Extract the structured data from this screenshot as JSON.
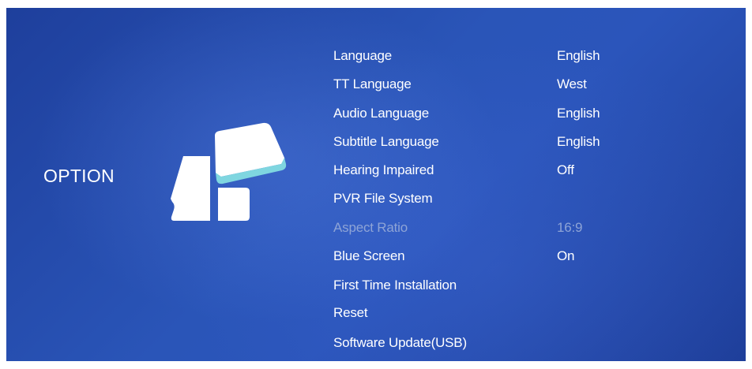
{
  "section": {
    "title": "OPTION"
  },
  "logo": {
    "icon": "option-settings-icon"
  },
  "colors": {
    "background": "#2a55b8",
    "text": "#ffffff",
    "disabled_text": "#8ea4d6",
    "logo_accent": "#7fd6e0"
  },
  "menu": {
    "items": [
      {
        "label": "Language",
        "value": "English",
        "enabled": true
      },
      {
        "label": "TT Language",
        "value": "West",
        "enabled": true
      },
      {
        "label": "Audio Language",
        "value": "English",
        "enabled": true
      },
      {
        "label": "Subtitle Language",
        "value": "English",
        "enabled": true
      },
      {
        "label": "Hearing Impaired",
        "value": "Off",
        "enabled": true
      },
      {
        "label": "PVR File System",
        "value": "",
        "enabled": true
      },
      {
        "label": "Aspect Ratio",
        "value": "16:9",
        "enabled": false
      },
      {
        "label": "Blue Screen",
        "value": "On",
        "enabled": true
      },
      {
        "label": "First Time Installation",
        "value": "",
        "enabled": true
      },
      {
        "label": "Reset",
        "value": "",
        "enabled": true
      },
      {
        "label": "Software Update(USB)",
        "value": "",
        "enabled": true
      }
    ]
  }
}
